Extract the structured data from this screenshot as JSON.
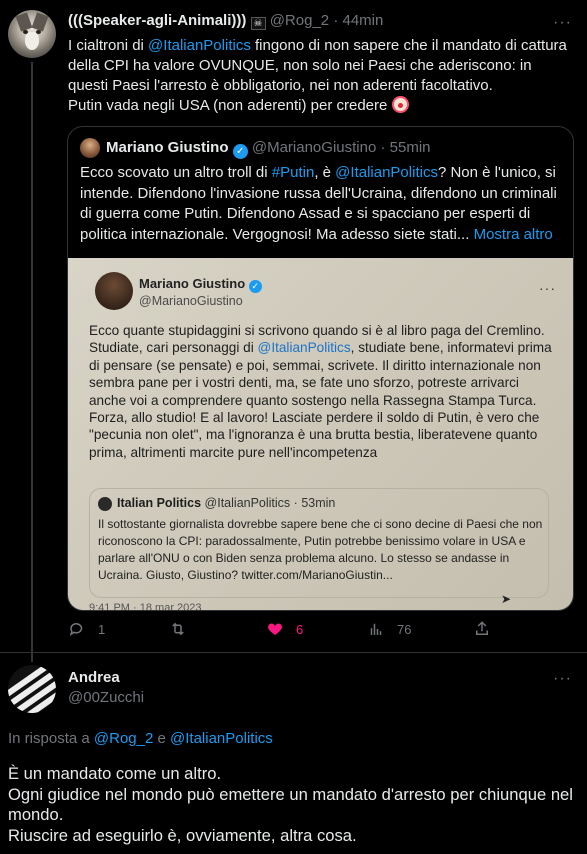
{
  "tweet1": {
    "display_name": "(((Speaker-agli-Animali)))",
    "flag_glyph": "☠",
    "handle": "@Rog_2",
    "separator": "·",
    "time": "44min",
    "body_part1": "I cialtroni di ",
    "body_mention": "@ItalianPolitics",
    "body_part2": " fingono di non sapere che il mandato di cattura della CPI ha valore OVUNQUE, non solo nei Paesi che aderiscono: in questi Paesi l'arresto è obbligatorio, nei non aderenti facoltativo.",
    "body_line2": "Putin vada negli USA (non aderenti) per credere",
    "emoji": "clown-face",
    "quote": {
      "display_name": "Mariano Giustino",
      "handle": "@MarianoGiustino",
      "separator": "·",
      "time": "55min",
      "text_part1": "Ecco scovato un altro troll di ",
      "text_hashtag": "#Putin",
      "text_part2": ", è ",
      "text_mention": "@ItalianPolitics",
      "text_part3": "? Non è l'unico, si intende. Difendono l'invasione russa dell'Ucraina, difendono un criminali di guerra come Putin. Difendono Assad e si spacciano per esperti di politica internazionale. Vergognosi! Ma adesso siete stati...",
      "show_more": "Mostra altro",
      "photo": {
        "display_name": "Mariano Giustino",
        "handle": "@MarianoGiustino",
        "text_part1": "Ecco quante stupidaggini si scrivono quando si è al libro paga del Cremlino. Studiate, cari personaggi di ",
        "text_mention": "@ItalianPolitics",
        "text_part2": ", studiate bene, informatevi prima di pensare (se pensate) e poi, semmai, scrivete. Il diritto internazionale non sembra pane per i vostri denti, ma, se fate uno sforzo, potreste arrivarci anche voi a comprendere quanto sostengo nella Rassegna Stampa Turca. Forza, allo studio! E al lavoro! Lasciate perdere il soldo di Putin, è vero che \"pecunia non olet\", ma l'ignoranza è una brutta bestia, liberatevene quanto prima, altrimenti marcite pure nell'incompetenza",
        "inner_quote": {
          "display_name": "Italian Politics",
          "handle": "@ItalianPolitics",
          "separator": "·",
          "time": "53min",
          "text": "Il sottostante giornalista dovrebbe sapere bene che ci sono decine di Paesi che non riconoscono la CPI: paradossalmente, Putin potrebbe benissimo volare in USA e parlare all'ONU o con Biden senza problema alcuno. Lo stesso se andasse in Ucraina. Giusto, Giustino? twitter.com/MarianoGiustin..."
        },
        "bottom_fragment": "9:41 PM · 18 mar 2023"
      }
    },
    "actions": {
      "replies": "1",
      "retweets": "",
      "likes": "6",
      "views": "76"
    }
  },
  "tweet2": {
    "display_name": "Andrea",
    "handle": "@00Zucchi",
    "reply_prefix": "In risposta a ",
    "reply_user1": "@Rog_2",
    "reply_joiner": " e ",
    "reply_user2": "@ItalianPolitics",
    "line1": "È un mandato come un altro.",
    "line2": "Ogni giudice nel mondo può emettere un mandato d'arresto per chiunque nel mondo.",
    "line3": "Riuscire ad eseguirlo è, ovviamente, altra cosa."
  },
  "more_glyph": "···",
  "colors": {
    "background": "#000000",
    "text": "#e7e9ea",
    "muted": "#71767b",
    "accent": "#1d9bf0",
    "like": "#f91880"
  }
}
